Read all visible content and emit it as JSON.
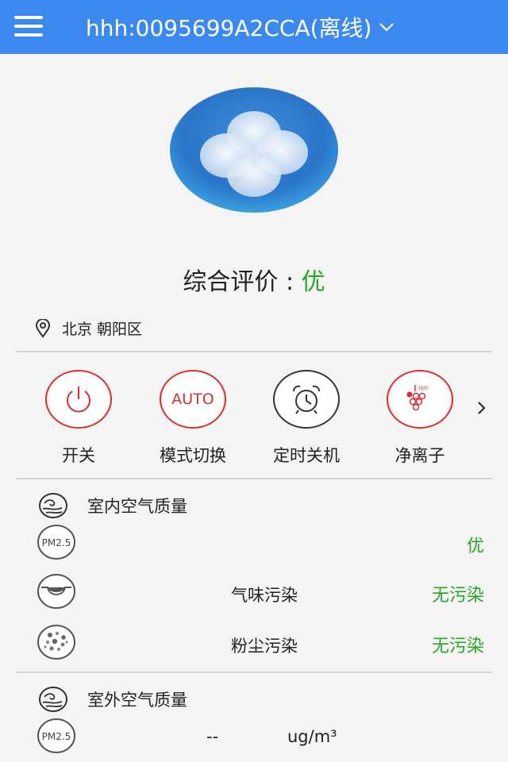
{
  "header": {
    "title": "hhh:0095699A2CCA(离线)",
    "menu_icon": "hamburger-icon",
    "dropdown_icon": "chevron-down-icon"
  },
  "hero": {
    "icon": "fan-icon"
  },
  "overall": {
    "label": "综合评价 : ",
    "grade": "优"
  },
  "location": {
    "text": "北京 朝阳区",
    "icon": "location-pin-icon"
  },
  "controls": [
    {
      "label": "开关",
      "icon": "power-icon"
    },
    {
      "label": "模式切换",
      "icon_text": "AUTO"
    },
    {
      "label": "定时关机",
      "icon": "alarm-clock-icon"
    },
    {
      "label": "净离子",
      "icon": "ion-icon",
      "icon_text": "ion"
    }
  ],
  "indoor": {
    "title": "室内空气质量",
    "rows": [
      {
        "icon": "pm25-icon",
        "icon_text": "PM2.5",
        "name": "",
        "status": "优"
      },
      {
        "icon": "odor-mask-icon",
        "name": "气味污染",
        "status": "无污染"
      },
      {
        "icon": "dust-icon",
        "name": "粉尘污染",
        "status": "无污染"
      }
    ]
  },
  "outdoor": {
    "title": "室外空气质量",
    "pm_icon_text": "PM2.5",
    "value": "--",
    "unit": "ug/m³"
  },
  "colors": {
    "header": "#3b88ee",
    "accent_red": "#d63030",
    "good_green": "#2aa52a"
  }
}
